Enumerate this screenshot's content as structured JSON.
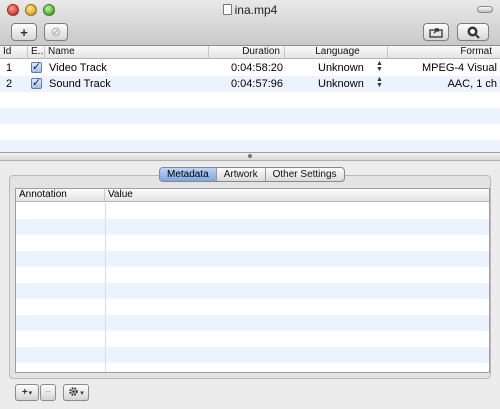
{
  "window": {
    "title": "ina.mp4"
  },
  "toolbar": {
    "add_label": "+",
    "remove_label": "⊘",
    "share_icon": "share-icon",
    "preview_icon": "preview-icon"
  },
  "tracks": {
    "columns": {
      "id": "Id",
      "enabled": "E...",
      "name": "Name",
      "duration": "Duration",
      "language": "Language",
      "format": "Format"
    },
    "rows": [
      {
        "id": "1",
        "enabled": true,
        "name": "Video Track",
        "duration": "0:04:58:20",
        "language": "Unknown",
        "format": "MPEG-4 Visual"
      },
      {
        "id": "2",
        "enabled": true,
        "name": "Sound Track",
        "duration": "0:04:57:96",
        "language": "Unknown",
        "format": "AAC, 1 ch"
      }
    ]
  },
  "tabs": [
    {
      "label": "Metadata",
      "active": true
    },
    {
      "label": "Artwork",
      "active": false
    },
    {
      "label": "Other Settings",
      "active": false
    }
  ],
  "metadata": {
    "columns": {
      "annotation": "Annotation",
      "value": "Value"
    },
    "rows": []
  },
  "bottom_bar": {
    "add_label": "+",
    "add_caret": "▾",
    "remove_label": "−",
    "gear_icon": "gear-icon",
    "gear_caret": "▾"
  },
  "colors": {
    "stripe": "#edf3fe",
    "active_tab": "#7ea6e1"
  }
}
